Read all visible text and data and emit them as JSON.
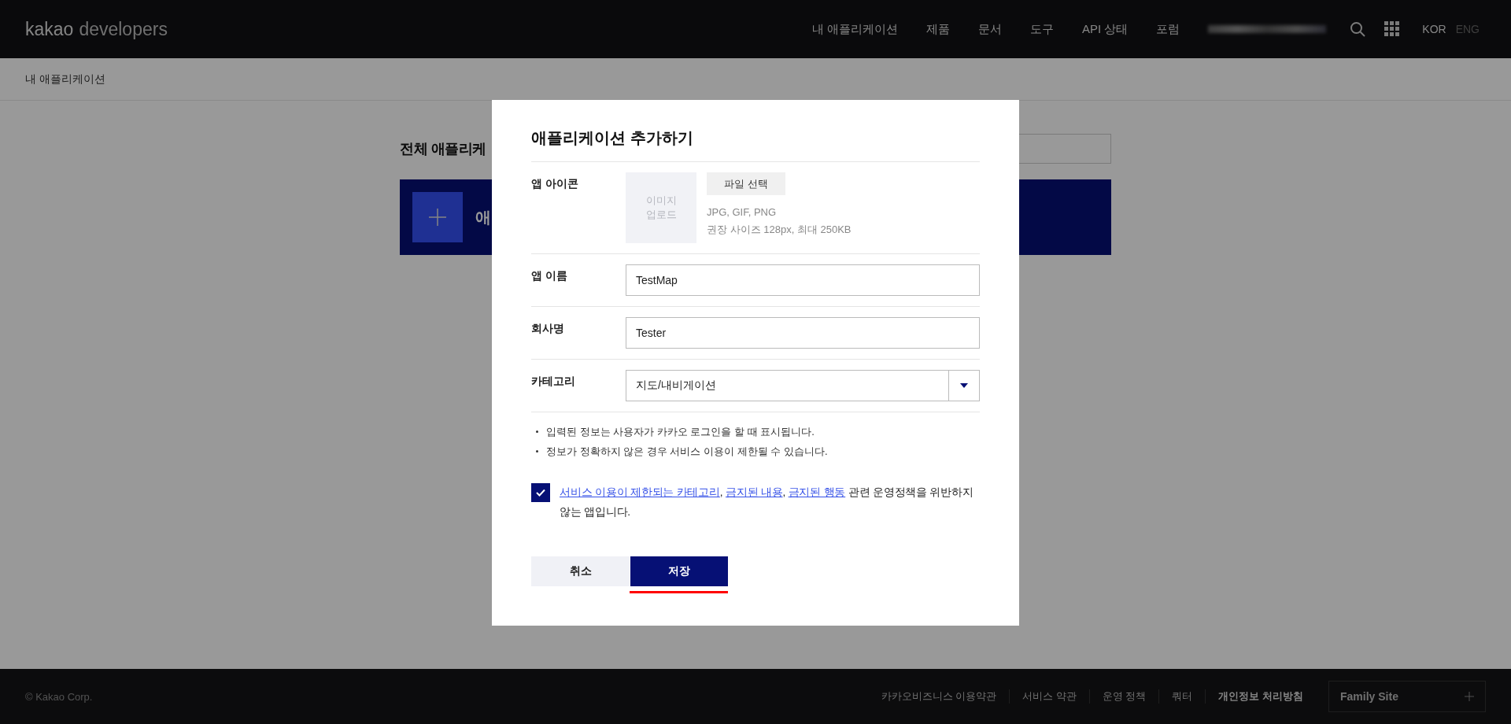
{
  "header": {
    "logo_bold": "kakao",
    "logo_light": "developers",
    "nav": [
      "내 애플리케이션",
      "제품",
      "문서",
      "도구",
      "API 상태",
      "포럼"
    ],
    "languages": [
      {
        "label": "KOR",
        "selected": true
      },
      {
        "label": "ENG",
        "selected": false
      }
    ]
  },
  "breadcrumb": "내 애플리케이션",
  "page": {
    "title": "전체 애플리케",
    "card_label": "애"
  },
  "dialog": {
    "title": "애플리케이션 추가하기",
    "icon_row": {
      "label": "앱 아이콘",
      "upload_box": [
        "이미지",
        "업로드"
      ],
      "file_button": "파일 선택",
      "hints": [
        "JPG, GIF, PNG",
        "권장 사이즈 128px, 최대 250KB"
      ]
    },
    "fields": [
      {
        "kind": "input",
        "label": "앱 이름",
        "value": "TestMap"
      },
      {
        "kind": "input",
        "label": "회사명",
        "value": "Tester"
      },
      {
        "kind": "select",
        "label": "카테고리",
        "value": "지도/내비게이션"
      }
    ],
    "notes": [
      "입력된 정보는 사용자가 카카오 로그인을 할 때 표시됩니다.",
      "정보가 정확하지 않은 경우 서비스 이용이 제한될 수 있습니다."
    ],
    "consent": {
      "checked": true,
      "parts": [
        {
          "kind": "link",
          "text": "서비스 이용이 제한되는 카테고리"
        },
        {
          "kind": "text",
          "text": ", "
        },
        {
          "kind": "link",
          "text": "금지된 내용"
        },
        {
          "kind": "text",
          "text": ", "
        },
        {
          "kind": "link",
          "text": "금지된 행동"
        },
        {
          "kind": "text",
          "text": " 관련 운영정책을 위반하지 않는 앱입니다."
        }
      ]
    },
    "buttons": [
      {
        "kind": "secondary",
        "label": "취소",
        "underlined": false
      },
      {
        "kind": "primary",
        "label": "저장",
        "underlined": true
      }
    ]
  },
  "footer": {
    "copyright": "© Kakao Corp.",
    "links": [
      {
        "text": "카카오비즈니스 이용약관",
        "bold": false
      },
      {
        "text": "서비스 약관",
        "bold": false
      },
      {
        "text": "운영 정책",
        "bold": false
      },
      {
        "text": "쿼터",
        "bold": false
      },
      {
        "text": "개인정보 처리방침",
        "bold": true
      }
    ],
    "family_site": "Family Site"
  }
}
